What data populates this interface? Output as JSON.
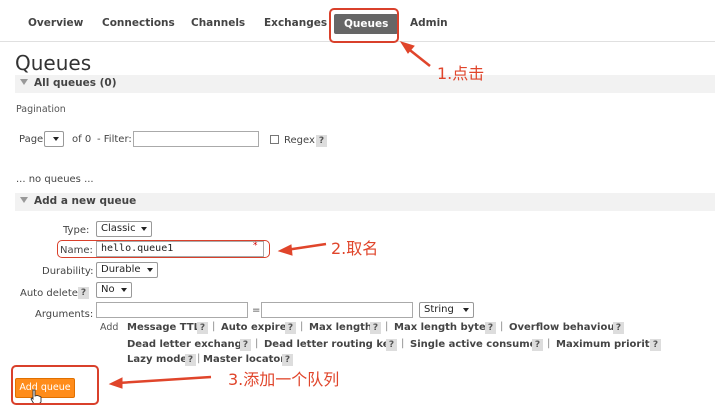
{
  "nav": {
    "tabs": [
      "Overview",
      "Connections",
      "Channels",
      "Exchanges",
      "Queues",
      "Admin"
    ]
  },
  "page": {
    "title": "Queues",
    "all_queues": "All queues (0)",
    "pagination": "Pagination",
    "page_label": "Page",
    "of_label": "of 0",
    "filter_label": "- Filter:",
    "regex_label": "Regex",
    "no_queues": "... no queues ..."
  },
  "form": {
    "section": "Add a new queue",
    "type_label": "Type:",
    "type_value": "Classic",
    "name_label": "Name:",
    "name_value": "hello.queue1",
    "required_mark": "*",
    "durability_label": "Durability:",
    "durability_value": "Durable",
    "auto_delete_label": "Auto delete:",
    "auto_delete_value": "No",
    "arguments_label": "Arguments:",
    "equals": "=",
    "arg_type_value": "String",
    "add_label": "Add",
    "args": [
      "Message TTL",
      "Auto expire",
      "Max length",
      "Max length bytes",
      "Overflow behaviour",
      "Dead letter exchange",
      "Dead letter routing key",
      "Single active consumer",
      "Maximum priority",
      "Lazy mode",
      "Master locator"
    ],
    "help": "?",
    "sep": "|",
    "submit": "Add queue"
  },
  "annotations": {
    "step1": "1.点击",
    "step2": "2.取名",
    "step3": "3.添加一个队列"
  },
  "colors": {
    "annotation": "#e0452b",
    "button": "#ff8c1a",
    "active_tab": "#666666"
  }
}
